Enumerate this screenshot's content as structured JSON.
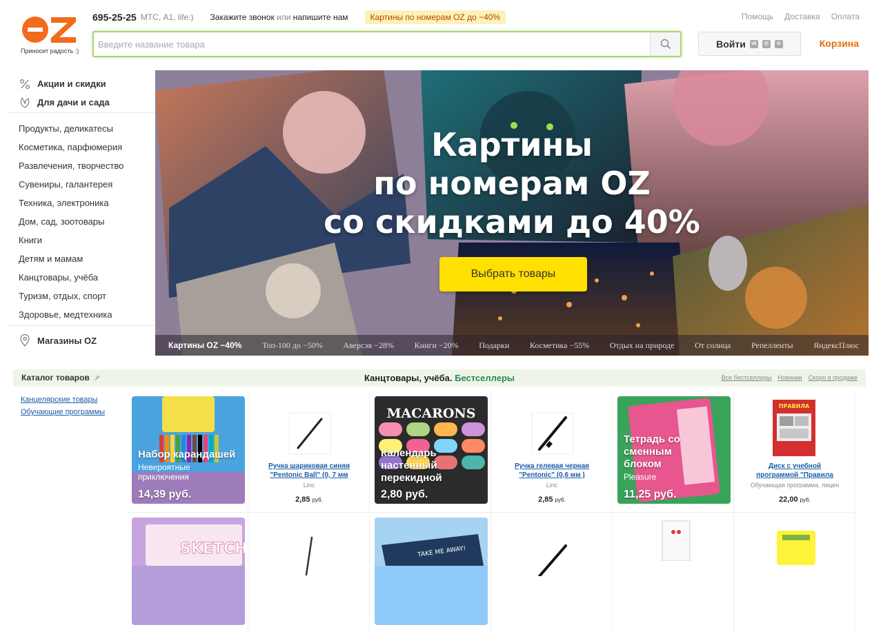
{
  "header": {
    "logo_tagline": "Приносит радость :)",
    "phone": "695-25-25",
    "operators": "МТС, A1, life:)",
    "callback_a": "Закажите звонок",
    "callback_or": " или ",
    "callback_b": "напишите нам",
    "promo_badge": "Картины по номерам OZ до −40%",
    "links": [
      "Помощь",
      "Доставка",
      "Оплата"
    ],
    "search_placeholder": "Введите название товара",
    "login_label": "Войти",
    "cart_label": "Корзина",
    "colors": {
      "brand_orange": "#f26a1b",
      "search_border": "#a9d36e",
      "cart": "#e46c0a"
    }
  },
  "sidebar": {
    "special": [
      {
        "label": "Акции и скидки",
        "icon": "percent-icon"
      },
      {
        "label": "Для дачи и сада",
        "icon": "leaf-icon"
      }
    ],
    "categories": [
      "Продукты, деликатесы",
      "Косметика, парфюмерия",
      "Развлечения, творчество",
      "Сувениры, галантерея",
      "Техника, электроника",
      "Дом, сад, зоотовары",
      "Книги",
      "Детям и мамам",
      "Канцтовары, учёба",
      "Туризм, отдых, спорт",
      "Здоровье, медтехника"
    ],
    "stores_label": "Магазины OZ"
  },
  "banner": {
    "title_lines": [
      "Картины",
      "по номерам OZ",
      "со скидками до 40%"
    ],
    "cta_label": "Выбрать товары",
    "tabs": [
      "Картины OZ −40%",
      "Топ-100 до −50%",
      "Аверсэв −28%",
      "Книги −20%",
      "Подарки",
      "Косметика −55%",
      "Отдых на природе",
      "От солнца",
      "Репелленты",
      "ЯндексПлюс"
    ],
    "active_tab": 0
  },
  "catalog": {
    "title": "Каталог товаров",
    "section": "Канцтовары, учёба.",
    "section_link": "Бестселлеры",
    "links": [
      "Все бестселлеры",
      "Новинки",
      "Скоро в продаже"
    ],
    "subcategories": [
      "Канцелярские товары",
      "Обучающие программы"
    ]
  },
  "products": [
    {
      "type": "promo",
      "title": "Набор карандашей",
      "subtitle": "Невероятные приключения",
      "price": "14,39 руб.",
      "bg": "#4aa3df"
    },
    {
      "type": "item",
      "title_1": "Ручка шариковая синяя",
      "title_2": "\"Pentonic Ball\" (0, 7 мм",
      "brand": "Linc",
      "price": "2,85",
      "currency": "руб."
    },
    {
      "type": "promo",
      "title": "Календарь настенный перекидной",
      "subtitle": "",
      "price": "2,80 руб.",
      "bg": "#2b2b2b"
    },
    {
      "type": "item",
      "title_1": "Ручка гелевая черная",
      "title_2": "\"Pentonic\" (0,6 мм )",
      "brand": "Linc",
      "price": "2,85",
      "currency": "руб."
    },
    {
      "type": "promo",
      "title": "Тетрадь со сменным блоком",
      "subtitle": "Pleasure",
      "price": "11,25 руб.",
      "bg": "#3aa35a"
    },
    {
      "type": "item",
      "title_1": "Диск с учебной",
      "title_2": "программой \"Правила",
      "brand": "Обучающая программа, лицен",
      "price": "22,00",
      "currency": "руб."
    }
  ]
}
